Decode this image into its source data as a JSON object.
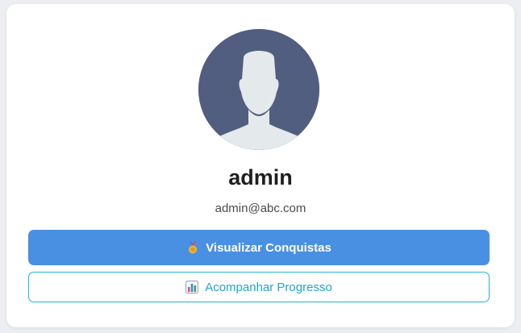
{
  "profile": {
    "name": "admin",
    "email": "admin@abc.com"
  },
  "actions": {
    "achievements_label": "Visualizar Conquistas",
    "achievements_icon": "medal-icon",
    "progress_label": "Acompanhar Progresso",
    "progress_icon": "bar-chart-icon"
  },
  "colors": {
    "primary": "#4a90e2",
    "outline": "#1fb6d6",
    "avatar_bg": "#525e80"
  }
}
